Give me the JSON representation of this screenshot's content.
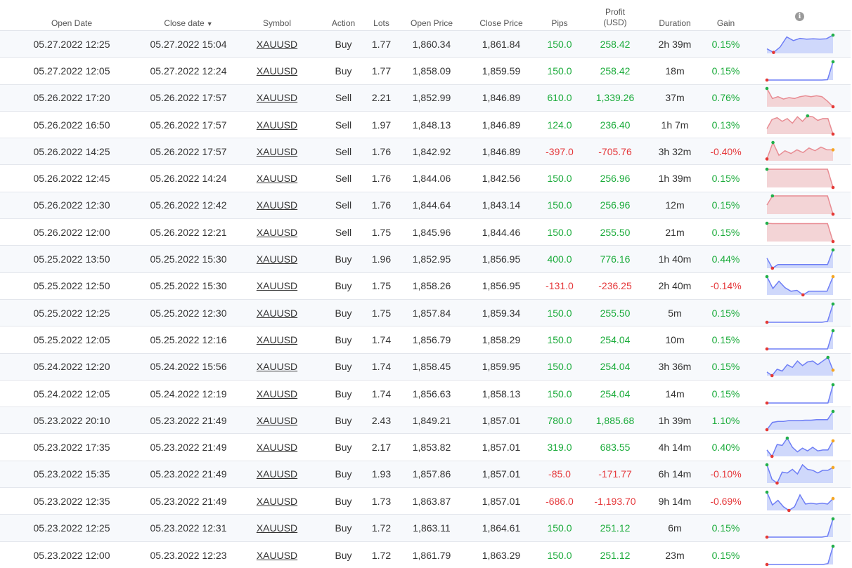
{
  "colors": {
    "positive": "#1aab3a",
    "negative": "#e5383b",
    "buy_fill": "#cfd8fb",
    "buy_line": "#6e7ef5",
    "sell_fill": "#f3d4d6",
    "sell_line": "#e88c93"
  },
  "header": {
    "open_date": "Open Date",
    "close_date": "Close date",
    "sort_indicator": "▼",
    "symbol": "Symbol",
    "action": "Action",
    "lots": "Lots",
    "open_price": "Open Price",
    "close_price": "Close Price",
    "pips": "Pips",
    "profit_line1": "Profit",
    "profit_line2": "(USD)",
    "duration": "Duration",
    "gain": "Gain",
    "info_icon": "info-icon"
  },
  "rows": [
    {
      "open": "05.27.2022 12:25",
      "close": "05.27.2022 15:04",
      "symbol": "XAUUSD",
      "action": "Buy",
      "lots": "1.77",
      "open_price": "1,860.34",
      "close_price": "1,861.84",
      "pips": "150.0",
      "profit": "258.42",
      "duration": "2h 39m",
      "gain": "0.15%",
      "spark": [
        0.25,
        0.05,
        0.35,
        0.9,
        0.7,
        0.82,
        0.78,
        0.8,
        0.78,
        0.8,
        1.0
      ]
    },
    {
      "open": "05.27.2022 12:05",
      "close": "05.27.2022 12:24",
      "symbol": "XAUUSD",
      "action": "Buy",
      "lots": "1.77",
      "open_price": "1,858.09",
      "close_price": "1,859.59",
      "pips": "150.0",
      "profit": "258.42",
      "duration": "18m",
      "gain": "0.15%",
      "spark": [
        0,
        0,
        0,
        0,
        0,
        0,
        0,
        0,
        0,
        0,
        0,
        0.02,
        1.0
      ]
    },
    {
      "open": "05.26.2022 17:20",
      "close": "05.26.2022 17:57",
      "symbol": "XAUUSD",
      "action": "Sell",
      "lots": "2.21",
      "open_price": "1,852.99",
      "close_price": "1,846.89",
      "pips": "610.0",
      "profit": "1,339.26",
      "duration": "37m",
      "gain": "0.76%",
      "spark": [
        1.0,
        0.45,
        0.55,
        0.42,
        0.5,
        0.45,
        0.55,
        0.6,
        0.55,
        0.6,
        0.55,
        0.3,
        0.0
      ]
    },
    {
      "open": "05.26.2022 16:50",
      "close": "05.26.2022 17:57",
      "symbol": "XAUUSD",
      "action": "Sell",
      "lots": "1.97",
      "open_price": "1,848.13",
      "close_price": "1,846.89",
      "pips": "124.0",
      "profit": "236.40",
      "duration": "1h 7m",
      "gain": "0.13%",
      "spark": [
        0.3,
        0.8,
        0.9,
        0.7,
        0.85,
        0.6,
        0.95,
        0.7,
        1.0,
        0.95,
        0.75,
        0.85,
        0.85,
        0.0
      ]
    },
    {
      "open": "05.26.2022 14:25",
      "close": "05.26.2022 17:57",
      "symbol": "XAUUSD",
      "action": "Sell",
      "lots": "1.76",
      "open_price": "1,842.92",
      "close_price": "1,846.89",
      "pips": "-397.0",
      "profit": "-705.76",
      "duration": "3h 32m",
      "gain": "-0.40%",
      "spark": [
        0.1,
        1.0,
        0.3,
        0.55,
        0.4,
        0.6,
        0.45,
        0.7,
        0.55,
        0.75,
        0.6,
        0.6
      ]
    },
    {
      "open": "05.26.2022 12:45",
      "close": "05.26.2022 14:24",
      "symbol": "XAUUSD",
      "action": "Sell",
      "lots": "1.76",
      "open_price": "1,844.06",
      "close_price": "1,842.56",
      "pips": "150.0",
      "profit": "256.96",
      "duration": "1h 39m",
      "gain": "0.15%",
      "spark": [
        1.0,
        1.0,
        1.0,
        1.0,
        1.0,
        1.0,
        1.0,
        1.0,
        1.0,
        1.0,
        1.0,
        1.0,
        0.0
      ]
    },
    {
      "open": "05.26.2022 12:30",
      "close": "05.26.2022 12:42",
      "symbol": "XAUUSD",
      "action": "Sell",
      "lots": "1.76",
      "open_price": "1,844.64",
      "close_price": "1,843.14",
      "pips": "150.0",
      "profit": "256.96",
      "duration": "12m",
      "gain": "0.15%",
      "spark": [
        0.5,
        1.0,
        1.0,
        1.0,
        1.0,
        1.0,
        1.0,
        1.0,
        1.0,
        1.0,
        1.0,
        1.0,
        0.0
      ]
    },
    {
      "open": "05.26.2022 12:00",
      "close": "05.26.2022 12:21",
      "symbol": "XAUUSD",
      "action": "Sell",
      "lots": "1.75",
      "open_price": "1,845.96",
      "close_price": "1,844.46",
      "pips": "150.0",
      "profit": "255.50",
      "duration": "21m",
      "gain": "0.15%",
      "spark": [
        1.0,
        0.98,
        0.98,
        0.98,
        0.98,
        0.98,
        0.98,
        0.98,
        0.98,
        0.98,
        0.98,
        0.98,
        0.0
      ]
    },
    {
      "open": "05.25.2022 13:50",
      "close": "05.25.2022 15:30",
      "symbol": "XAUUSD",
      "action": "Buy",
      "lots": "1.96",
      "open_price": "1,852.95",
      "close_price": "1,856.95",
      "pips": "400.0",
      "profit": "776.16",
      "duration": "1h 40m",
      "gain": "0.44%",
      "spark": [
        0.55,
        0.0,
        0.2,
        0.2,
        0.2,
        0.2,
        0.2,
        0.2,
        0.2,
        0.2,
        0.2,
        0.2,
        1.0
      ]
    },
    {
      "open": "05.25.2022 12:50",
      "close": "05.25.2022 15:30",
      "symbol": "XAUUSD",
      "action": "Buy",
      "lots": "1.75",
      "open_price": "1,858.26",
      "close_price": "1,856.95",
      "pips": "-131.0",
      "profit": "-236.25",
      "duration": "2h 40m",
      "gain": "-0.14%",
      "spark": [
        1.0,
        0.35,
        0.75,
        0.4,
        0.2,
        0.25,
        0.0,
        0.2,
        0.2,
        0.2,
        0.2,
        1.0
      ]
    },
    {
      "open": "05.25.2022 12:25",
      "close": "05.25.2022 12:30",
      "symbol": "XAUUSD",
      "action": "Buy",
      "lots": "1.75",
      "open_price": "1,857.84",
      "close_price": "1,859.34",
      "pips": "150.0",
      "profit": "255.50",
      "duration": "5m",
      "gain": "0.15%",
      "spark": [
        0,
        0,
        0,
        0,
        0,
        0,
        0,
        0,
        0,
        0,
        0,
        0.05,
        1.0
      ]
    },
    {
      "open": "05.25.2022 12:05",
      "close": "05.25.2022 12:16",
      "symbol": "XAUUSD",
      "action": "Buy",
      "lots": "1.74",
      "open_price": "1,856.79",
      "close_price": "1,858.29",
      "pips": "150.0",
      "profit": "254.04",
      "duration": "10m",
      "gain": "0.15%",
      "spark": [
        0,
        0,
        0,
        0,
        0,
        0,
        0,
        0,
        0,
        0,
        0,
        0,
        1.0
      ]
    },
    {
      "open": "05.24.2022 12:20",
      "close": "05.24.2022 15:56",
      "symbol": "XAUUSD",
      "action": "Buy",
      "lots": "1.74",
      "open_price": "1,858.45",
      "close_price": "1,859.95",
      "pips": "150.0",
      "profit": "254.04",
      "duration": "3h 36m",
      "gain": "0.15%",
      "spark": [
        0.2,
        0.0,
        0.35,
        0.25,
        0.6,
        0.45,
        0.8,
        0.55,
        0.75,
        0.8,
        0.6,
        0.8,
        1.0,
        0.3
      ]
    },
    {
      "open": "05.24.2022 12:05",
      "close": "05.24.2022 12:19",
      "symbol": "XAUUSD",
      "action": "Buy",
      "lots": "1.74",
      "open_price": "1,856.63",
      "close_price": "1,858.13",
      "pips": "150.0",
      "profit": "254.04",
      "duration": "14m",
      "gain": "0.15%",
      "spark": [
        0,
        0,
        0,
        0,
        0,
        0,
        0,
        0,
        0,
        0,
        0,
        0,
        0,
        1.0
      ]
    },
    {
      "open": "05.23.2022 20:10",
      "close": "05.23.2022 21:49",
      "symbol": "XAUUSD",
      "action": "Buy",
      "lots": "2.43",
      "open_price": "1,849.21",
      "close_price": "1,857.01",
      "pips": "780.0",
      "profit": "1,885.68",
      "duration": "1h 39m",
      "gain": "1.10%",
      "spark": [
        0.0,
        0.4,
        0.45,
        0.45,
        0.5,
        0.5,
        0.5,
        0.52,
        0.52,
        0.55,
        0.55,
        0.55,
        1.0
      ]
    },
    {
      "open": "05.23.2022 17:35",
      "close": "05.23.2022 21:49",
      "symbol": "XAUUSD",
      "action": "Buy",
      "lots": "2.17",
      "open_price": "1,853.82",
      "close_price": "1,857.01",
      "pips": "319.0",
      "profit": "683.55",
      "duration": "4h 14m",
      "gain": "0.40%",
      "spark": [
        0.35,
        0.0,
        0.65,
        0.6,
        1.0,
        0.5,
        0.25,
        0.45,
        0.3,
        0.5,
        0.3,
        0.35,
        0.35,
        0.85
      ]
    },
    {
      "open": "05.23.2022 15:35",
      "close": "05.23.2022 21:49",
      "symbol": "XAUUSD",
      "action": "Buy",
      "lots": "1.93",
      "open_price": "1,857.86",
      "close_price": "1,857.01",
      "pips": "-85.0",
      "profit": "-171.77",
      "duration": "6h 14m",
      "gain": "-0.10%",
      "spark": [
        1.0,
        0.2,
        0.0,
        0.6,
        0.55,
        0.75,
        0.5,
        1.0,
        0.75,
        0.7,
        0.55,
        0.7,
        0.7,
        0.85
      ]
    },
    {
      "open": "05.23.2022 12:35",
      "close": "05.23.2022 21:49",
      "symbol": "XAUUSD",
      "action": "Buy",
      "lots": "1.73",
      "open_price": "1,863.87",
      "close_price": "1,857.01",
      "pips": "-686.0",
      "profit": "-1,193.70",
      "duration": "9h 14m",
      "gain": "-0.69%",
      "spark": [
        1.0,
        0.3,
        0.55,
        0.2,
        0.0,
        0.2,
        0.85,
        0.35,
        0.4,
        0.35,
        0.4,
        0.35,
        0.65
      ]
    },
    {
      "open": "05.23.2022 12:25",
      "close": "05.23.2022 12:31",
      "symbol": "XAUUSD",
      "action": "Buy",
      "lots": "1.72",
      "open_price": "1,863.11",
      "close_price": "1,864.61",
      "pips": "150.0",
      "profit": "251.12",
      "duration": "6m",
      "gain": "0.15%",
      "spark": [
        0,
        0,
        0,
        0,
        0,
        0,
        0,
        0,
        0,
        0,
        0,
        0.05,
        1.0
      ]
    },
    {
      "open": "05.23.2022 12:00",
      "close": "05.23.2022 12:23",
      "symbol": "XAUUSD",
      "action": "Buy",
      "lots": "1.72",
      "open_price": "1,861.79",
      "close_price": "1,863.29",
      "pips": "150.0",
      "profit": "251.12",
      "duration": "23m",
      "gain": "0.15%",
      "spark": [
        0,
        0,
        0,
        0,
        0,
        0,
        0,
        0,
        0,
        0,
        0,
        0,
        0.05,
        1.0
      ]
    }
  ]
}
